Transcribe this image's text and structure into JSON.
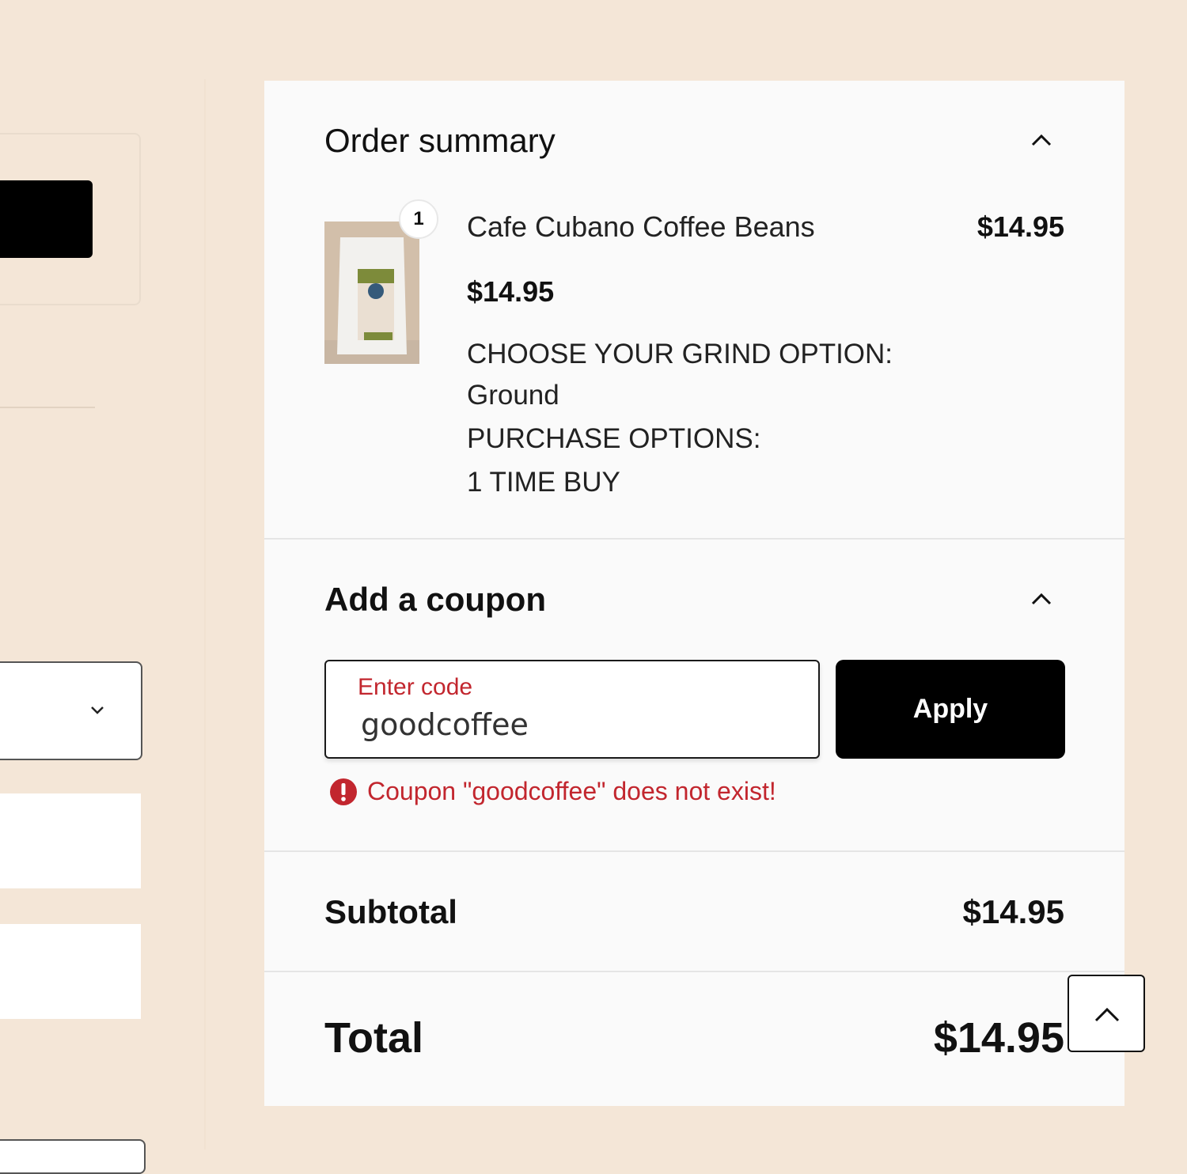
{
  "order_summary": {
    "title": "Order summary",
    "item": {
      "quantity": "1",
      "name": "Cafe Cubano Coffee Beans",
      "price": "$14.95",
      "unit_price": "$14.95",
      "options": [
        "CHOOSE YOUR GRIND OPTION:",
        "Ground",
        "PURCHASE OPTIONS:",
        "1 TIME BUY"
      ]
    }
  },
  "coupon": {
    "title": "Add a coupon",
    "field_label": "Enter code",
    "value": "goodcoffee",
    "apply_label": "Apply",
    "error": "Coupon \"goodcoffee\" does not exist!"
  },
  "totals": {
    "subtotal_label": "Subtotal",
    "subtotal_value": "$14.95",
    "total_label": "Total",
    "total_value": "$14.95"
  },
  "colors": {
    "page_background": "#f4e6d7",
    "error": "#c2262e",
    "button": "#000000"
  },
  "icons": [
    "chevron-up-icon",
    "chevron-down-icon",
    "error-icon",
    "scroll-top-icon"
  ]
}
